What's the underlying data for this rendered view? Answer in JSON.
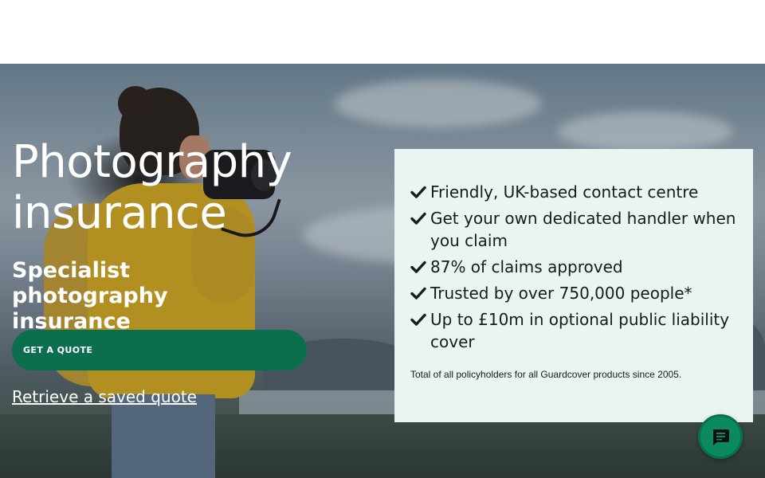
{
  "hero": {
    "title": "Photography insurance",
    "subtitle": "Specialist photography insurance",
    "quote_button_label": "GET A QUOTE",
    "retrieve_link_label": "Retrieve a saved quote"
  },
  "benefits": {
    "items": [
      {
        "label": "Friendly, UK-based contact centre",
        "icon": "check-icon"
      },
      {
        "label": "Get your own dedicated handler when you claim",
        "icon": "check-icon"
      },
      {
        "label": "87% of claims approved",
        "icon": "check-icon"
      },
      {
        "label": "Trusted by over 750,000 people*",
        "icon": "check-icon"
      },
      {
        "label": "Up to £10m in optional public liability cover",
        "icon": "check-icon"
      }
    ],
    "footnote": "Total of all policyholders for all Guardcover products since 2005."
  },
  "chat": {
    "icon": "chat-icon"
  },
  "colors": {
    "brand_green": "#0b6e4f",
    "chat_green": "#0b8a5f",
    "card_background": "#eaf4f0",
    "text_dark": "#1a1a1a"
  }
}
